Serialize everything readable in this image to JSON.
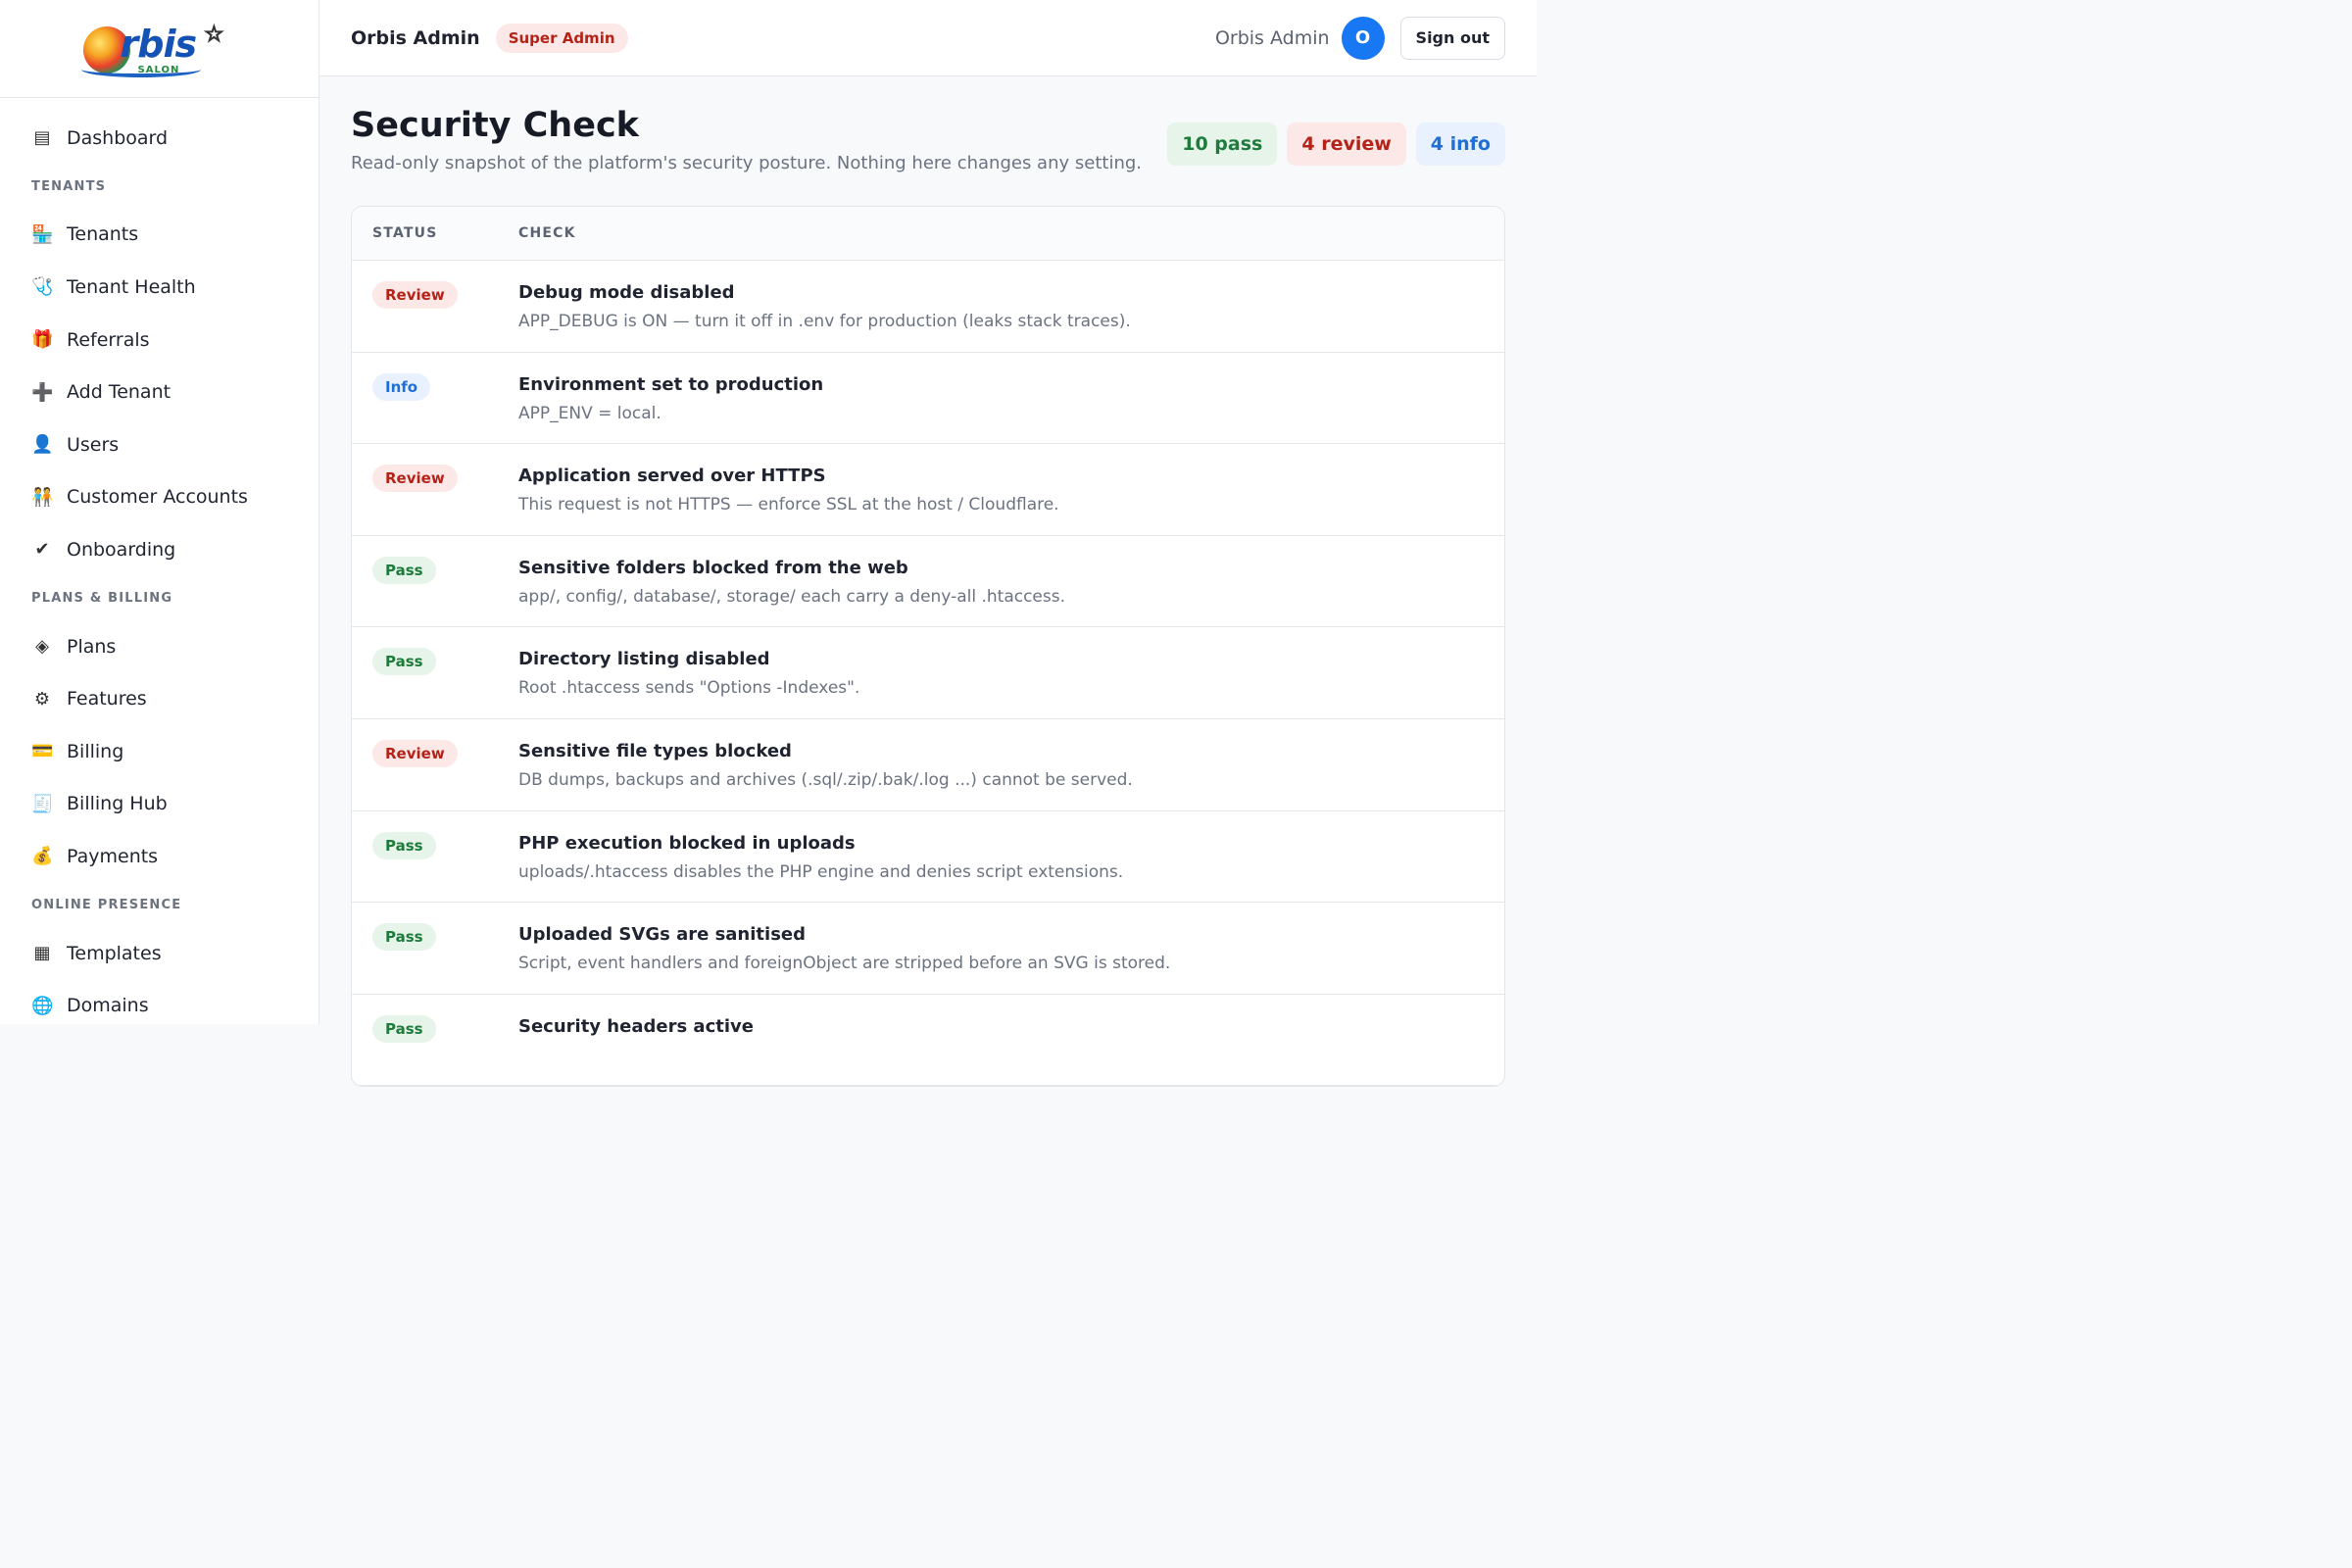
{
  "logo": {
    "text": "rbis",
    "sub": "SALON"
  },
  "sidebar": {
    "items_top": [
      {
        "label": "Dashboard",
        "icon": "dashboard-icon",
        "glyph": "▤"
      }
    ],
    "sections": [
      {
        "title": "TENANTS",
        "items": [
          {
            "label": "Tenants",
            "icon": "store-icon",
            "glyph": "🏪"
          },
          {
            "label": "Tenant Health",
            "icon": "stethoscope-icon",
            "glyph": "🩺"
          },
          {
            "label": "Referrals",
            "icon": "gift-icon",
            "glyph": "🎁"
          },
          {
            "label": "Add Tenant",
            "icon": "plus-icon",
            "glyph": "➕"
          },
          {
            "label": "Users",
            "icon": "user-icon",
            "glyph": "👤"
          },
          {
            "label": "Customer Accounts",
            "icon": "people-icon",
            "glyph": "🧑‍🤝‍🧑"
          },
          {
            "label": "Onboarding",
            "icon": "checkmark-icon",
            "glyph": "✔"
          }
        ]
      },
      {
        "title": "PLANS & BILLING",
        "items": [
          {
            "label": "Plans",
            "icon": "diamond-icon",
            "glyph": "◈"
          },
          {
            "label": "Features",
            "icon": "gear-icon",
            "glyph": "⚙"
          },
          {
            "label": "Billing",
            "icon": "credit-card-icon",
            "glyph": "💳"
          },
          {
            "label": "Billing Hub",
            "icon": "receipt-icon",
            "glyph": "🧾"
          },
          {
            "label": "Payments",
            "icon": "money-bag-icon",
            "glyph": "💰"
          }
        ]
      },
      {
        "title": "ONLINE PRESENCE",
        "items": [
          {
            "label": "Templates",
            "icon": "grid-icon",
            "glyph": "▦"
          },
          {
            "label": "Domains",
            "icon": "globe-icon",
            "glyph": "🌐"
          }
        ]
      }
    ]
  },
  "header": {
    "title": "Orbis Admin",
    "role": "Super Admin",
    "user_name": "Orbis Admin",
    "avatar_initial": "O",
    "signout_label": "Sign out"
  },
  "page": {
    "title": "Security Check",
    "subtitle": "Read-only snapshot of the platform's security posture. Nothing here changes any setting.",
    "summary": {
      "pass": "10 pass",
      "review": "4 review",
      "info": "4 info"
    }
  },
  "table": {
    "headers": {
      "status": "STATUS",
      "check": "CHECK"
    },
    "rows": [
      {
        "status": "Review",
        "kind": "review",
        "title": "Debug mode disabled",
        "desc": "APP_DEBUG is ON — turn it off in .env for production (leaks stack traces)."
      },
      {
        "status": "Info",
        "kind": "info",
        "title": "Environment set to production",
        "desc": "APP_ENV = local."
      },
      {
        "status": "Review",
        "kind": "review",
        "title": "Application served over HTTPS",
        "desc": "This request is not HTTPS — enforce SSL at the host / Cloudflare."
      },
      {
        "status": "Pass",
        "kind": "pass",
        "title": "Sensitive folders blocked from the web",
        "desc": "app/, config/, database/, storage/ each carry a deny-all .htaccess."
      },
      {
        "status": "Pass",
        "kind": "pass",
        "title": "Directory listing disabled",
        "desc": "Root .htaccess sends \"Options -Indexes\"."
      },
      {
        "status": "Review",
        "kind": "review",
        "title": "Sensitive file types blocked",
        "desc": "DB dumps, backups and archives (.sql/.zip/.bak/.log ...) cannot be served."
      },
      {
        "status": "Pass",
        "kind": "pass",
        "title": "PHP execution blocked in uploads",
        "desc": "uploads/.htaccess disables the PHP engine and denies script extensions."
      },
      {
        "status": "Pass",
        "kind": "pass",
        "title": "Uploaded SVGs are sanitised",
        "desc": "Script, event handlers and foreignObject are stripped before an SVG is stored."
      },
      {
        "status": "Pass",
        "kind": "pass",
        "title": "Security headers active",
        "desc": ""
      }
    ]
  }
}
